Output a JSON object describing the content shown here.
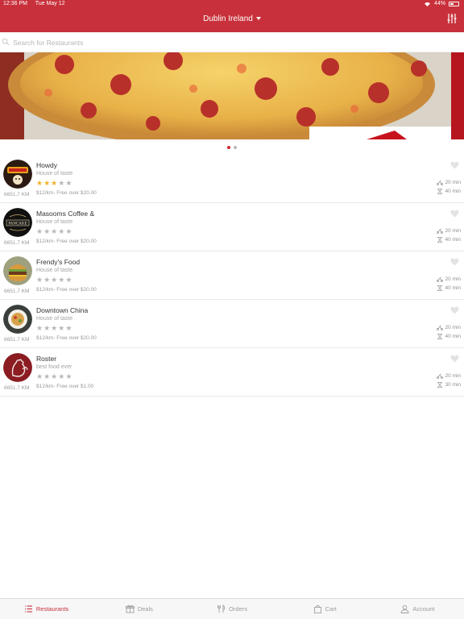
{
  "status_bar": {
    "time": "12:36 PM",
    "date": "Tue May 12",
    "battery": "44%"
  },
  "header": {
    "location": "Dublin Ireland",
    "filter_icon": "sliders-icon",
    "accent_color": "#c8313b"
  },
  "search": {
    "placeholder": "Search for Restaurants",
    "value": ""
  },
  "banner": {
    "image": "pizza-photo",
    "pages": 2,
    "current_page": 1
  },
  "restaurants": [
    {
      "name": "Howdy",
      "tagline": "House of taste",
      "rating": 3,
      "distance": "6651.7 KM",
      "fee": "$12/km- Free over $20.00",
      "delivery_time": "20 min",
      "pickup_time": "40 min",
      "logo": "howdy-logo"
    },
    {
      "name": "Masooms Coffee &",
      "tagline": "House of taste",
      "rating": 0,
      "distance": "6651.7 KM",
      "fee": "$12/km- Free over $20.00",
      "delivery_time": "20 min",
      "pickup_time": "40 min",
      "logo": "pancake-logo"
    },
    {
      "name": "Frendy's Food",
      "tagline": "House of taste",
      "rating": 0,
      "distance": "6651.7 KM",
      "fee": "$12/km- Free over $20.00",
      "delivery_time": "20 min",
      "pickup_time": "40 min",
      "logo": "burger-logo"
    },
    {
      "name": "Downtown China",
      "tagline": "House of taste",
      "rating": 0,
      "distance": "6651.7 KM",
      "fee": "$12/km- Free over $20.00",
      "delivery_time": "20 min",
      "pickup_time": "40 min",
      "logo": "noodle-bowl-logo"
    },
    {
      "name": "Roster",
      "tagline": "best food ever",
      "rating": 0,
      "distance": "6651.7 KM",
      "fee": "$12/km- Free over $1.00",
      "delivery_time": "20 min",
      "pickup_time": "30 min",
      "logo": "rooster-logo"
    }
  ],
  "tabs": [
    {
      "label": "Restaurants",
      "icon": "list-icon",
      "active": true
    },
    {
      "label": "Deals",
      "icon": "gift-icon",
      "active": false
    },
    {
      "label": "Orders",
      "icon": "cutlery-icon",
      "active": false
    },
    {
      "label": "Cart",
      "icon": "bag-icon",
      "active": false
    },
    {
      "label": "Account",
      "icon": "user-icon",
      "active": false
    }
  ]
}
